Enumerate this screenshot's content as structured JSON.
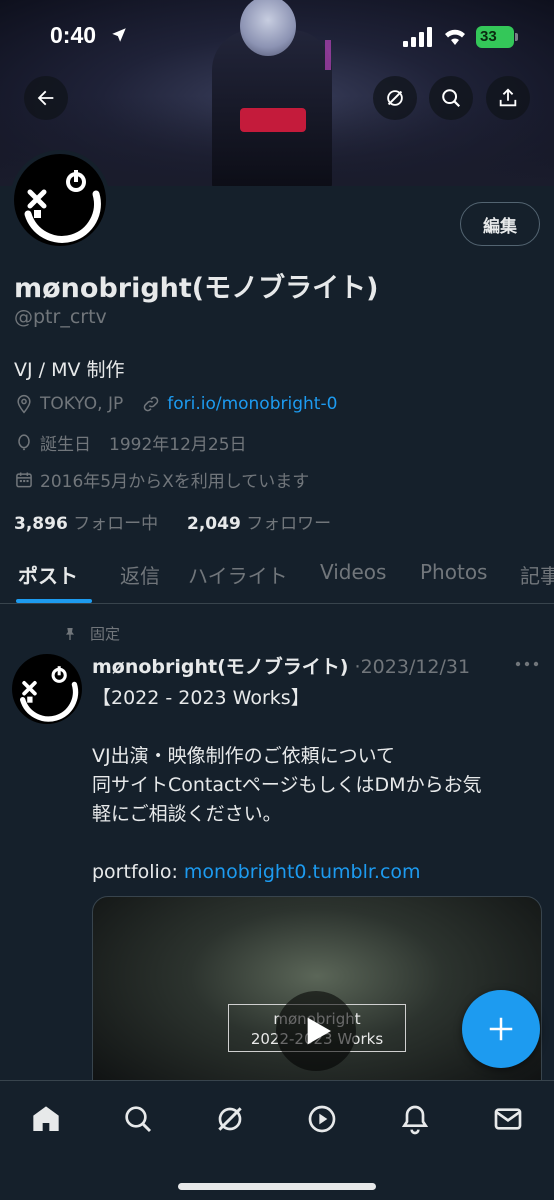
{
  "status_bar": {
    "time": "0:40",
    "battery": "33"
  },
  "header": {
    "back_icon": "arrow-left-icon",
    "grok_icon": "grok-icon",
    "search_icon": "search-icon",
    "share_icon": "share-icon"
  },
  "profile": {
    "name": "mønobright(モノブライト)",
    "handle": "@ptr_crtv",
    "edit_label": "編集",
    "bio": "VJ / MV 制作",
    "location": "TOKYO, JP",
    "website": "fori.io/monobright-0",
    "birthday_label": "誕生日",
    "birthday": "1992年12月25日",
    "joined": "2016年5月からXを利用しています",
    "following_count": "3,896",
    "following_label": "フォロー中",
    "followers_count": "2,049",
    "followers_label": "フォロワー"
  },
  "tabs": [
    {
      "label": "ポスト",
      "active": true
    },
    {
      "label": "返信"
    },
    {
      "label": "ハイライト"
    },
    {
      "label": "Videos"
    },
    {
      "label": "Photos"
    },
    {
      "label": "記事"
    }
  ],
  "post": {
    "pinned_label": "固定",
    "author": "mønobright(モノブライト)",
    "separator": "·",
    "date": "2023/12/31",
    "line1": "【2022 - 2023 Works】",
    "line2": "VJ出演・映像制作のご依頼について",
    "line3": "同サイトContactページもしくはDMからお気",
    "line4": "軽にご相談ください。",
    "portfolio_label": "portfolio: ",
    "portfolio_link": "monobright0.tumblr.com",
    "media_title_1": "mønobright",
    "media_title_2": "2022-2023 Works"
  },
  "colors": {
    "background": "#15202b",
    "accent": "#1d9bf0",
    "muted": "#71767b",
    "text": "#e7e9ea"
  }
}
